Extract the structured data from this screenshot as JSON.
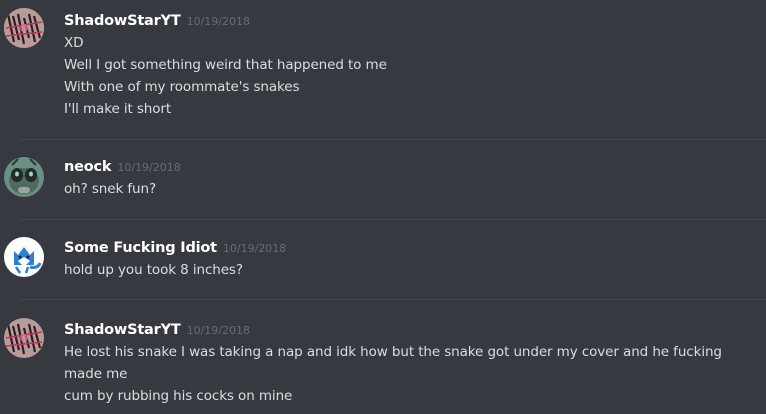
{
  "groups": [
    {
      "username": "ShadowStarYT",
      "timestamp": "10/19/2018",
      "messages": [
        "XD",
        "Well I got something weird that happened to me",
        "With one of my roommate's snakes",
        "I'll make it short"
      ]
    },
    {
      "username": "neock",
      "timestamp": "10/19/2018",
      "messages": [
        "oh? snek fun?"
      ]
    },
    {
      "username": "Some Fucking Idiot",
      "timestamp": "10/19/2018",
      "messages": [
        "hold up you took 8 inches?"
      ]
    },
    {
      "username": "ShadowStarYT",
      "timestamp": "10/19/2018",
      "messages": [
        "He lost his snake I was taking a nap and idk how but the snake got under my cover and he fucking made me",
        "cum by rubbing his cocks on mine"
      ]
    }
  ],
  "colors": {
    "background": "#36393f",
    "username": "#ffffff",
    "timestamp": "#686b70",
    "message": "#dcddde",
    "divider": "#42454a"
  },
  "icons": [
    "avatar-shadowstaryt-icon",
    "avatar-neock-icon",
    "avatar-fox-icon"
  ]
}
